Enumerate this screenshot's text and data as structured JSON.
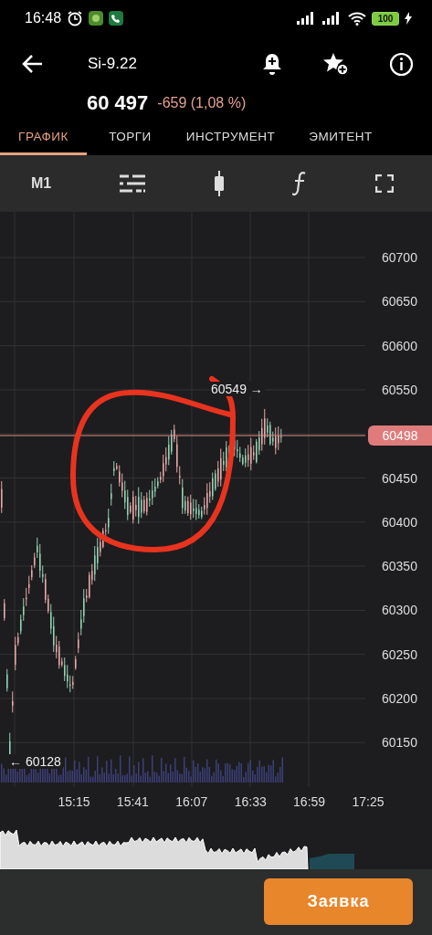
{
  "status_bar": {
    "time": "16:48",
    "battery": "100"
  },
  "header": {
    "title": "Si-9.22",
    "price": "60 497",
    "change": "-659 (1,08 %)"
  },
  "tabs": [
    {
      "label": "ГРАФИК",
      "selected": true
    },
    {
      "label": "ТОРГИ",
      "selected": false
    },
    {
      "label": "ИНСТРУМЕНТ",
      "selected": false
    },
    {
      "label": "ЭМИТЕНТ",
      "selected": false
    }
  ],
  "toolbar": {
    "interval": "M1"
  },
  "chart": {
    "y_labels": [
      "60700",
      "60650",
      "60600",
      "60550",
      "60450",
      "60400",
      "60350",
      "60300",
      "60250",
      "60200",
      "60150"
    ],
    "x_labels": [
      "15:15",
      "15:41",
      "16:07",
      "16:33",
      "16:59",
      "17:25"
    ],
    "last_price": "60498",
    "high_label": "60549 →",
    "low_label": "← 60128"
  },
  "order_button": "Заявка"
}
